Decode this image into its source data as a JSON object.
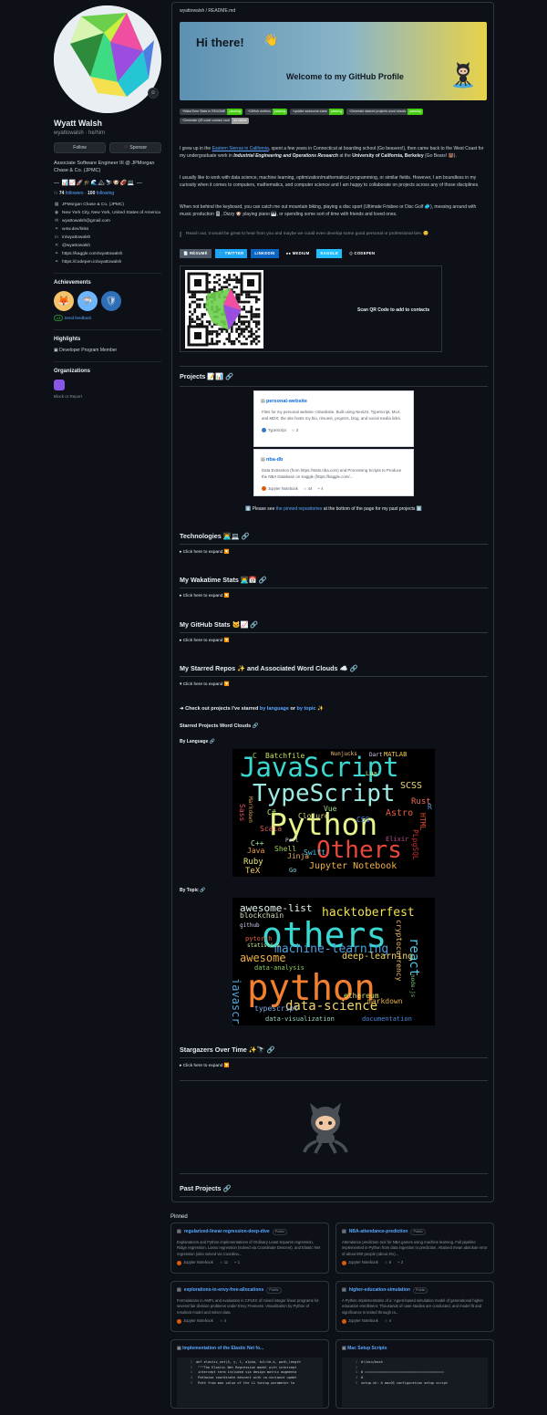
{
  "profile": {
    "name": "Wyatt Walsh",
    "login": "wyattowalsh · he/him",
    "follow_label": "Follow",
    "sponsor_label": "Sponsor",
    "bio": "Associate Software Engineer III @ JPMorgan Chase & Co. (JPMC)",
    "emoji_line": "— 📊📈🚀🎓🌊🏔⛷🐶🏈💻 —",
    "followers": "74",
    "followers_label": "followers",
    "following": "100",
    "following_label": "following",
    "meta": [
      {
        "icon": "organization-icon",
        "glyph": "▦",
        "text": "JPMorgan Chase & Co. (JPMC)"
      },
      {
        "icon": "location-icon",
        "glyph": "◉",
        "text": "New York City, New York, United States of America"
      },
      {
        "icon": "mail-icon",
        "glyph": "✉",
        "text": "wyattowalsh@gmail.com"
      },
      {
        "icon": "link-icon",
        "glyph": "⚭",
        "text": "w4w.dev/links"
      },
      {
        "icon": "linkedin-icon",
        "glyph": "in",
        "text": "in/wyattowalsh"
      },
      {
        "icon": "twitter-icon",
        "glyph": "✕",
        "text": "@wyattowalsh"
      },
      {
        "icon": "link-icon",
        "glyph": "⚭",
        "text": "https://kaggle.com/wyattowalsh"
      },
      {
        "icon": "link-icon",
        "glyph": "⚭",
        "text": "https://codepen.io/wyattowalsh"
      }
    ],
    "achievements_heading": "Achievements",
    "achievement_x3": "x3",
    "send_feedback": "Send feedback",
    "highlights_heading": "Highlights",
    "highlight": "Developer Program Member",
    "organizations_heading": "Organizations",
    "report": "Block or Report"
  },
  "readme": {
    "path": "wyattowalsh / README.md",
    "banner_hi": "Hi there!",
    "banner_wave": "👋",
    "banner_welcome": "Welcome to my GitHub Profile",
    "badges": [
      {
        "label": "WakaTime Stats in README",
        "status": "passing",
        "gray": false
      },
      {
        "label": "GitHub metrics",
        "status": "passing",
        "gray": false
      },
      {
        "label": "update awesome-stars",
        "status": "passing",
        "gray": false
      },
      {
        "label": "Generate starred projects word clouds",
        "status": "passing",
        "gray": false
      },
      {
        "label": "Generate QR code contact card",
        "status": "no status",
        "gray": true
      }
    ],
    "p1_pre": "I grew up in the ",
    "p1_link": "Eastern Sierras in California",
    "p1_post": ", spent a few years in Connecticut at boarding school (Go beavers!), then came back to the West Coast for my undergraduate work in ",
    "p1_field": "Industrial Engineering and Operations Research",
    "p1_at": " at the ",
    "p1_school": "University of California, Berkeley",
    "p1_end": " (Go Bears! 🐻).",
    "p2": "I usually like to work with data science, machine learning, optimization/mathematical programming, or similar fields. However, I am boundless in my curiosity when it comes to computers, mathematics, and computer science and I am happy to collaborate on projects across any of those disciplines.",
    "p3": "When not behind the keyboard, you can catch me out mountain biking, playing a disc sport (Ultimate Frisbee or Disc Golf 🥏), messing around with music production 🎚️, Dizzy 🐶 playing piano 🎹, or spending some sort of time with friends and loved ones.",
    "quote": "Reach out, it would be great to hear from you and maybe we could even develop some good personal or professional ties. 😊",
    "social": [
      {
        "label": "📄 RÉSUMÉ",
        "color": "#4d5966"
      },
      {
        "label": "🐦 TWITTER",
        "color": "#1da1f2"
      },
      {
        "label": "LINKEDIN",
        "color": "#0a66c2"
      },
      {
        "label": "●● MEDIUM",
        "color": "#0d1117"
      },
      {
        "label": "KAGGLE",
        "color": "#20beff"
      },
      {
        "label": "⟨⟩ CODEPEN",
        "color": "#0d1117"
      }
    ],
    "qr_text": "Scan QR Code to add to contacts",
    "projects_heading": "Projects 📝📊",
    "project_cards": [
      {
        "name": "personal-website",
        "desc": "Files for my personal website <4/website. Built using NextJS, TypeScript, MUI, and MDX; the site hosts my bio, résumé, projects, blog, and social media links.",
        "lang": "TypeScript",
        "lang_color": "#3178c6",
        "stars": "3",
        "forks": ""
      },
      {
        "name": "nba-db",
        "desc": "Data Extraction (from https://stats.nba.com) and Processing Scripts to Produce the NBA Database on Kaggle (https://kaggle.com/...",
        "lang": "Jupyter Notebook",
        "lang_color": "#da5b0b",
        "stars": "44",
        "forks": "4"
      }
    ],
    "past_note_pre": "⬇️ Please see ",
    "past_note_link": "the pinned repositories",
    "past_note_post": " at the bottom of the page for my past projects ⬇️",
    "technologies": "Technologies 👨‍💻💻",
    "wakatime": "My Wakatime Stats 👨‍💻📅",
    "github_stats": "My GitHub Stats 🐱📈",
    "starred": "My Starred Repos ✨ and Associated Word Clouds ☁️",
    "expand": "▸ Click here to expand 🔽",
    "expand_open": "▾ Click here to expand 🔽",
    "check_pre": "➜ Check out projects I've starred ",
    "check_lang": "by language",
    "check_or": " or ",
    "check_topic": "by topic",
    "check_end": " ✨",
    "wordclouds_heading": "Starred Projects Word Clouds",
    "by_language": "By Language",
    "by_topic": "By Topic",
    "stargazers": "Stargazers Over Time ✨🔭",
    "past_projects": "Past Projects"
  },
  "wordcloud_language": [
    {
      "t": "JavaScript",
      "c": "#3ad6d0"
    },
    {
      "t": "TypeScript",
      "c": "#9fe9e3"
    },
    {
      "t": "Python",
      "c": "#e7f28a"
    },
    {
      "t": "Others",
      "c": "#e8483b"
    },
    {
      "t": "Jupyter Notebook",
      "c": "#f0b14a"
    },
    {
      "t": "C",
      "c": "#8ad25c"
    },
    {
      "t": "Batchfile",
      "c": "#bfe25b"
    },
    {
      "t": "Nunjucks",
      "c": "#f5c07a"
    },
    {
      "t": "Dart",
      "c": "#d9c6ee"
    },
    {
      "t": "MATLAB",
      "c": "#f2c94c"
    },
    {
      "t": "Lua",
      "c": "#c8e87a"
    },
    {
      "t": "SCSS",
      "c": "#efdf7a"
    },
    {
      "t": "Rust",
      "c": "#f06a58"
    },
    {
      "t": "Astro",
      "c": "#e86040"
    },
    {
      "t": "Vue",
      "c": "#9edc7d"
    },
    {
      "t": "Clojure",
      "c": "#d8d27a"
    },
    {
      "t": "C#",
      "c": "#b7e86a"
    },
    {
      "t": "CSS",
      "c": "#4c8be0"
    },
    {
      "t": "Scala",
      "c": "#e26060"
    },
    {
      "t": "C++",
      "c": "#a8eeb0"
    },
    {
      "t": "Java",
      "c": "#e9a048"
    },
    {
      "t": "Shell",
      "c": "#a8cf58"
    },
    {
      "t": "Jinja",
      "c": "#eeb05a"
    },
    {
      "t": "Swift",
      "c": "#52c7ef"
    },
    {
      "t": "Ruby",
      "c": "#e8e87a"
    },
    {
      "t": "TeX",
      "c": "#f0d060"
    },
    {
      "t": "Go",
      "c": "#7ed0e0"
    },
    {
      "t": "HTML",
      "c": "#e34c26"
    },
    {
      "t": "PLpgSQL",
      "c": "#cb3030"
    },
    {
      "t": "Elixir",
      "c": "#c05090"
    },
    {
      "t": "Sass",
      "c": "#e05060"
    },
    {
      "t": "Markdown",
      "c": "#d6a050"
    },
    {
      "t": "Perl",
      "c": "#c0c0e0"
    },
    {
      "t": "R",
      "c": "#4aa0e0"
    }
  ],
  "wordcloud_topic": [
    {
      "t": "others",
      "c": "#3ad6d0"
    },
    {
      "t": "python",
      "c": "#f08030"
    },
    {
      "t": "awesome-list",
      "c": "#e6f7f0"
    },
    {
      "t": "hacktoberfest",
      "c": "#f2e052"
    },
    {
      "t": "awesome",
      "c": "#f0b040"
    },
    {
      "t": "machine-learning",
      "c": "#4aa0e0"
    },
    {
      "t": "deep-learning",
      "c": "#f2d66a"
    },
    {
      "t": "data-science",
      "c": "#f2d66a"
    },
    {
      "t": "react",
      "c": "#58c7e8"
    },
    {
      "t": "blockchain",
      "c": "#cfe0b8"
    },
    {
      "t": "javascript",
      "c": "#52a8e0"
    },
    {
      "t": "ethereum",
      "c": "#e0e060"
    },
    {
      "t": "markdown",
      "c": "#e8b050"
    },
    {
      "t": "typescript",
      "c": "#7db0f0"
    },
    {
      "t": "data-visualization",
      "c": "#9ad6c8"
    },
    {
      "t": "documentation",
      "c": "#4c8be0"
    },
    {
      "t": "cryptocurrency",
      "c": "#f0c060"
    },
    {
      "t": "data-analysis",
      "c": "#8ad25c"
    },
    {
      "t": "pytorch",
      "c": "#e06040"
    },
    {
      "t": "statistics",
      "c": "#c0e890"
    },
    {
      "t": "github",
      "c": "#d0d0f0"
    },
    {
      "t": "node-js",
      "c": "#7ec87e"
    }
  ],
  "pinned": {
    "heading": "Pinned",
    "public_label": "Public",
    "repos": [
      {
        "name": "regularized-linear-regression-deep-dive",
        "desc": "Explanations and Python implementations of Ordinary Least Squares regression, Ridge regression, Lasso regression (solved via Coordinate Descent), and Elastic Net regression (also solved via Coordina...",
        "lang": "Jupyter Notebook",
        "stars": "11",
        "forks": "1"
      },
      {
        "name": "NBA-attendance-prediction",
        "desc": "Attendance prediction tool for NBA games using machine learning. Full pipeline implemented in Python from data ingestion to prediction. Attained mean absolute error of about 800 people (about 4%)...",
        "lang": "Jupyter Notebook",
        "stars": "8",
        "forks": "3"
      },
      {
        "name": "explorations-in-envy-free-allocations",
        "desc": "Formulations in AMPL and evaluation in CPLEX of mixed integer linear programs for several fair division problems under Envy Freeness. Visualization by Python of resultant model and solver data.",
        "lang": "Jupyter Notebook",
        "stars": "4",
        "forks": ""
      },
      {
        "name": "higher-education-simulation",
        "desc": "A Python implementation of a ¨Agent-based simulation model of generational higher education enrollment. Thousands of case studies are conducted, and model fit and significance is tested through ra...",
        "lang": "Jupyter Notebook",
        "stars": "4",
        "forks": ""
      }
    ],
    "gists": [
      {
        "name": "Implementation of the Elastic Net fo...",
        "lines": [
          {
            "n": "1",
            "t": "def elastic_net(X, y, l, alpha, tol=1e-4, path_length"
          },
          {
            "n": "2",
            "t": "    \"\"\"The Elastic Net Regression model with intercept"
          },
          {
            "n": "3",
            "t": "    intercept term included via design matrix augmenta"
          },
          {
            "n": "4",
            "t": "    Pathwise coordinate descent with co-variance updat"
          },
          {
            "n": "5",
            "t": "    Path from max value of the L1 tuning parameter to"
          }
        ]
      },
      {
        "name": "Mac Setup Scripts",
        "lines": [
          {
            "n": "1",
            "t": "#!/bin/bash"
          },
          {
            "n": "2",
            "t": ""
          },
          {
            "n": "3",
            "t": "# ========================================"
          },
          {
            "n": "4",
            "t": "#"
          },
          {
            "n": "5",
            "t": "setup.sh: A macOS configuration setup script"
          }
        ]
      }
    ]
  }
}
